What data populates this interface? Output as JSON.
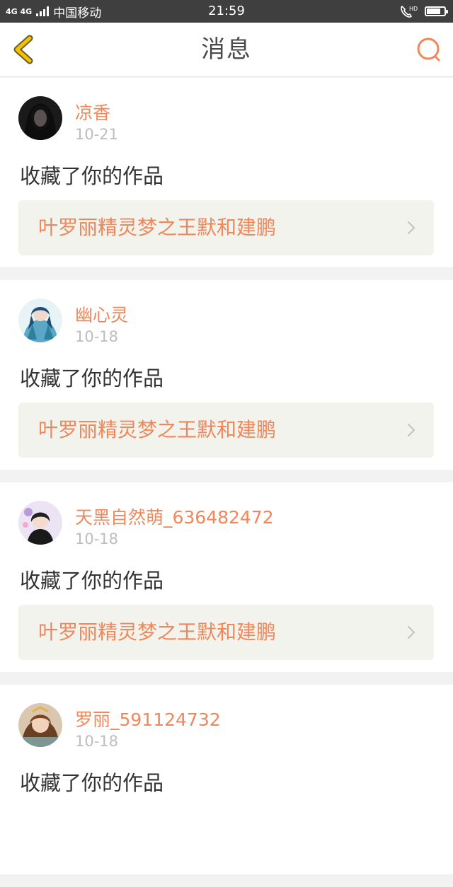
{
  "status_bar": {
    "network": "4G 4G",
    "carrier": "中国移动",
    "time": "21:59",
    "hd_label": "HD",
    "battery_level": 0.8
  },
  "nav": {
    "title": "消息",
    "back_icon": "chevron-left-icon",
    "search_icon": "search-icon",
    "accent_color": "#f0875a",
    "back_color": "#f2c200"
  },
  "messages": [
    {
      "user": "凉香",
      "date": "10-21",
      "action": "收藏了你的作品",
      "work_title": "叶罗丽精灵梦之王默和建鹏"
    },
    {
      "user": "幽心灵",
      "date": "10-18",
      "action": "收藏了你的作品",
      "work_title": "叶罗丽精灵梦之王默和建鹏"
    },
    {
      "user": "天黑自然萌_636482472",
      "date": "10-18",
      "action": "收藏了你的作品",
      "work_title": "叶罗丽精灵梦之王默和建鹏"
    },
    {
      "user": "罗丽_591124732",
      "date": "10-18",
      "action": "收藏了你的作品",
      "work_title": ""
    }
  ]
}
